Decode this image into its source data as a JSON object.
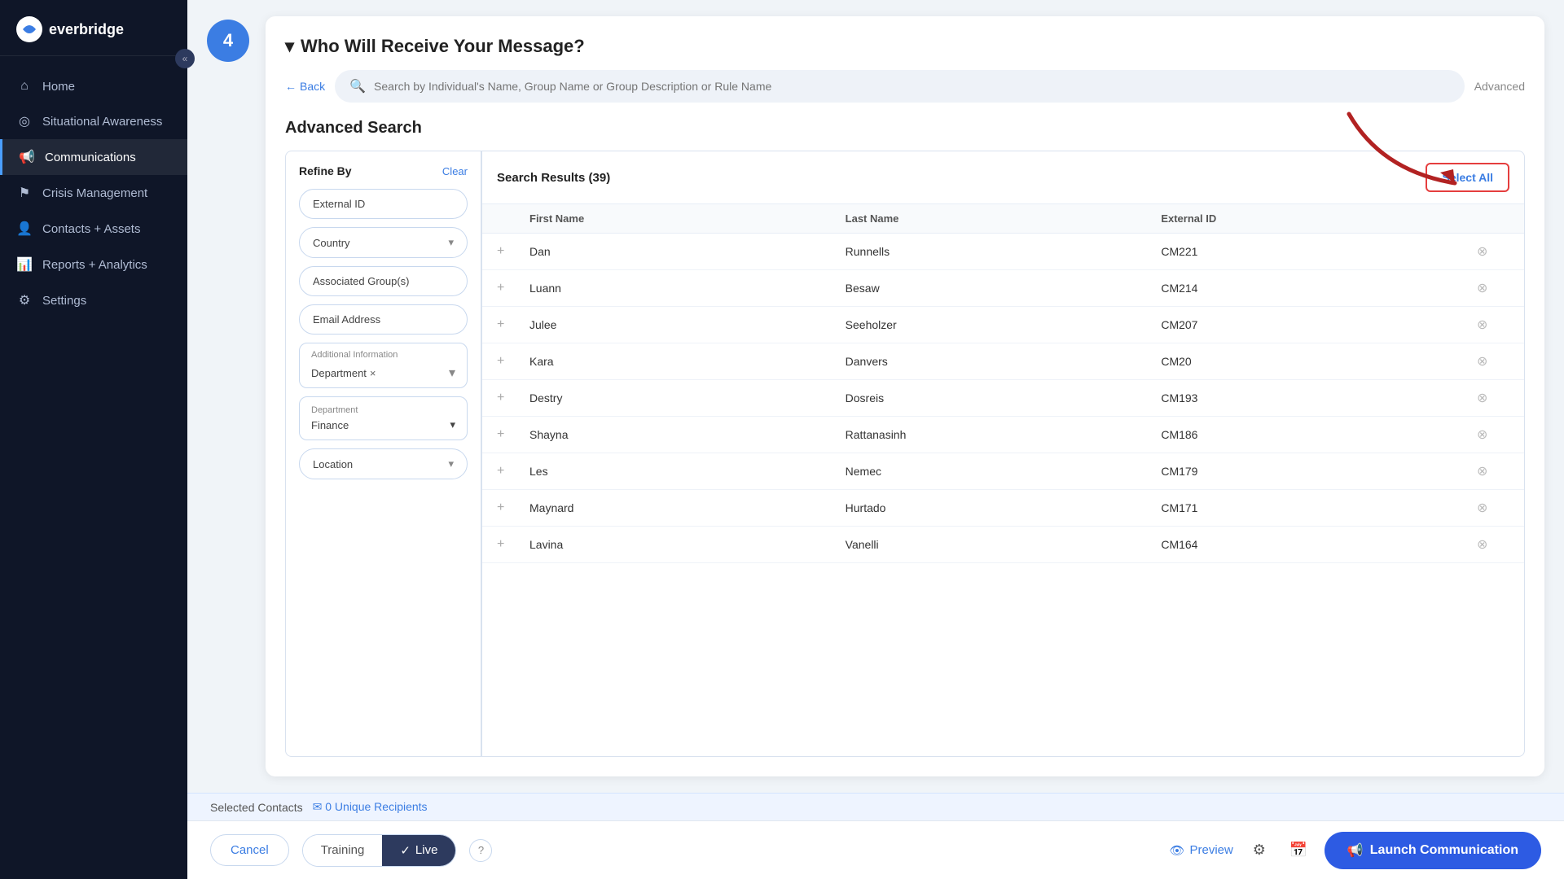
{
  "sidebar": {
    "logo_text": "everbridge",
    "collapse_icon": "«",
    "nav_items": [
      {
        "id": "home",
        "label": "Home",
        "icon": "⌂",
        "active": false
      },
      {
        "id": "situational-awareness",
        "label": "Situational Awareness",
        "icon": "◎",
        "active": false
      },
      {
        "id": "communications",
        "label": "Communications",
        "icon": "📢",
        "active": true
      },
      {
        "id": "crisis-management",
        "label": "Crisis Management",
        "icon": "⚑",
        "active": false
      },
      {
        "id": "contacts-assets",
        "label": "Contacts + Assets",
        "icon": "👤",
        "active": false
      },
      {
        "id": "reports-analytics",
        "label": "Reports + Analytics",
        "icon": "📊",
        "active": false
      },
      {
        "id": "settings",
        "label": "Settings",
        "icon": "⚙",
        "active": false
      }
    ]
  },
  "step": {
    "number": "4",
    "title": "Who Will Receive Your Message?",
    "title_arrow": "▾"
  },
  "search": {
    "placeholder": "Search by Individual's Name, Group Name or Group Description or Rule Name",
    "back_label": "Back",
    "advanced_label": "Advanced"
  },
  "advanced_search": {
    "title": "Advanced Search",
    "refine_by_label": "Refine By",
    "clear_label": "Clear",
    "fields": [
      {
        "id": "external-id",
        "label": "External ID",
        "type": "text",
        "has_dropdown": false
      },
      {
        "id": "country",
        "label": "Country",
        "type": "dropdown",
        "has_dropdown": true
      },
      {
        "id": "associated-groups",
        "label": "Associated Group(s)",
        "type": "text",
        "has_dropdown": false
      },
      {
        "id": "email-address",
        "label": "Email Address",
        "type": "text",
        "has_dropdown": false
      }
    ],
    "additional_info": {
      "label": "Additional Information",
      "department_tag": "Department",
      "tag_x": "×"
    },
    "department": {
      "label": "Department",
      "value": "Finance"
    },
    "location_field": {
      "label": "Location",
      "has_dropdown": true
    }
  },
  "results": {
    "title": "Search Results (39)",
    "select_all_label": "Select All",
    "columns": [
      {
        "id": "add",
        "label": ""
      },
      {
        "id": "first-name",
        "label": "First Name"
      },
      {
        "id": "last-name",
        "label": "Last Name"
      },
      {
        "id": "external-id",
        "label": "External ID"
      },
      {
        "id": "remove",
        "label": ""
      }
    ],
    "rows": [
      {
        "first_name": "Dan",
        "last_name": "Runnells",
        "external_id": "CM221"
      },
      {
        "first_name": "Luann",
        "last_name": "Besaw",
        "external_id": "CM214"
      },
      {
        "first_name": "Julee",
        "last_name": "Seeholzer",
        "external_id": "CM207"
      },
      {
        "first_name": "Kara",
        "last_name": "Danvers",
        "external_id": "CM20"
      },
      {
        "first_name": "Destry",
        "last_name": "Dosreis",
        "external_id": "CM193"
      },
      {
        "first_name": "Shayna",
        "last_name": "Rattanasinh",
        "external_id": "CM186"
      },
      {
        "first_name": "Les",
        "last_name": "Nemec",
        "external_id": "CM179"
      },
      {
        "first_name": "Maynard",
        "last_name": "Hurtado",
        "external_id": "CM171"
      },
      {
        "first_name": "Lavina",
        "last_name": "Vanelli",
        "external_id": "CM164"
      }
    ]
  },
  "bottom_bar": {
    "cancel_label": "Cancel",
    "training_label": "Training",
    "live_label": "Live",
    "live_check": "✓",
    "help_icon": "?",
    "preview_label": "Preview",
    "launch_label": "Launch Communication",
    "launch_icon": "📢"
  },
  "selected_bar": {
    "title": "Selected Contacts",
    "recipients_label": "0 Unique Recipients"
  },
  "colors": {
    "accent": "#3b7de3",
    "sidebar_bg": "#0f1628",
    "active_nav": "#4a9eff",
    "select_all_border": "#e53e3e"
  }
}
